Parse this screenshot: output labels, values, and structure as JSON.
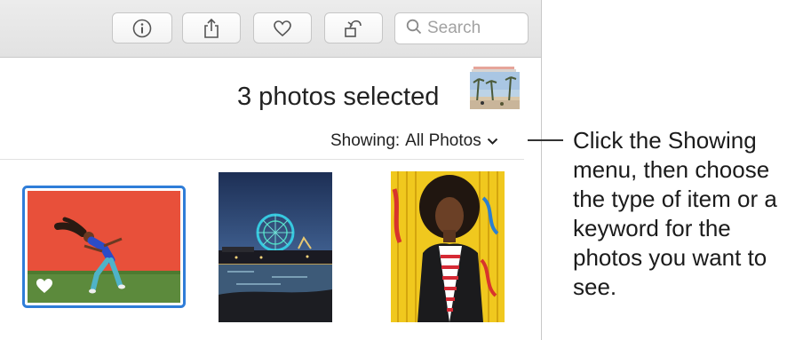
{
  "toolbar": {
    "buttons": [
      {
        "name": "info",
        "icon": "info-icon"
      },
      {
        "name": "share",
        "icon": "share-icon"
      },
      {
        "name": "favorite",
        "icon": "heart-icon"
      },
      {
        "name": "rotate",
        "icon": "rotate-icon"
      }
    ],
    "search": {
      "placeholder": "Search",
      "icon": "search-icon"
    }
  },
  "selection": {
    "summary": "3 photos selected"
  },
  "filter": {
    "label": "Showing:",
    "value": "All Photos",
    "icon": "chevron-down-icon"
  },
  "photos": [
    {
      "subject": "dancer against red wall",
      "favorite": true,
      "selected": true
    },
    {
      "subject": "pier ferris wheel at dusk",
      "favorite": false,
      "selected": false
    },
    {
      "subject": "woman against yellow wall",
      "favorite": false,
      "selected": false
    }
  ],
  "callout": {
    "text": "Click the Showing menu, then choose the type of item or a keyword for the photos you want to see."
  },
  "colors": {
    "selection_border": "#2f7dd8",
    "toolbar_bg": "#e6e6e6"
  }
}
